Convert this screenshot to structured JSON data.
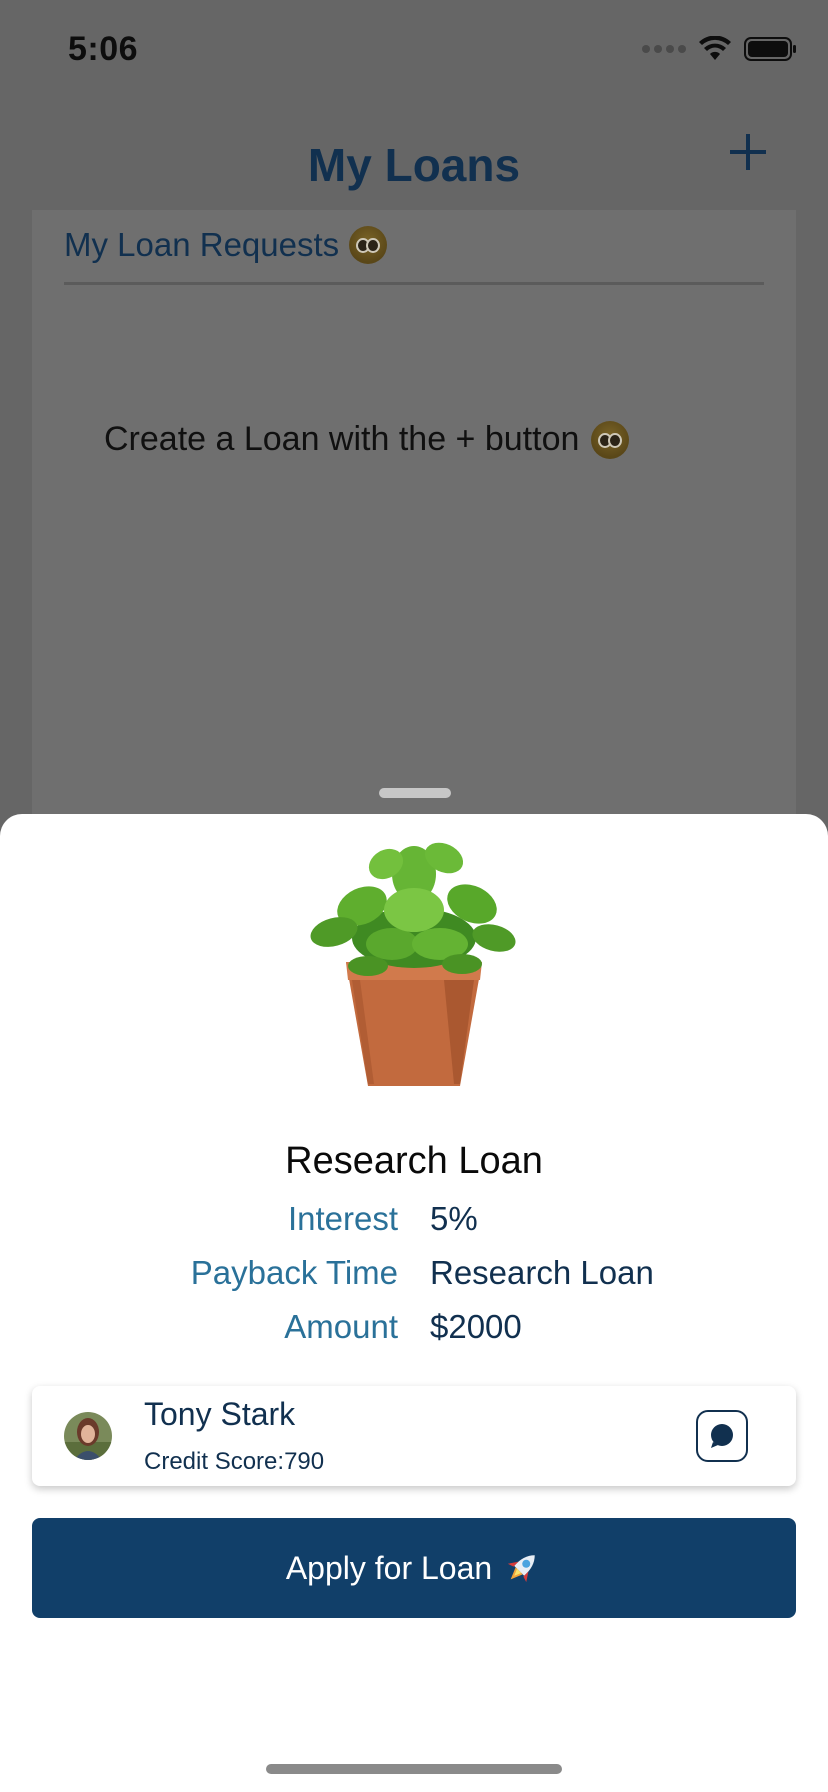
{
  "status_bar": {
    "time": "5:06"
  },
  "nav": {
    "title": "My Loans",
    "add_icon": "plus-icon"
  },
  "requests": {
    "header": "My Loan Requests",
    "empty_text": "Create a Loan with the + button"
  },
  "loan": {
    "title": "Research Loan",
    "image": "potted-plant",
    "details": [
      {
        "label": "Interest",
        "value": "5%"
      },
      {
        "label": "Payback Time",
        "value": "Research Loan"
      },
      {
        "label": "Amount",
        "value": "$2000"
      }
    ]
  },
  "lender": {
    "name": "Tony Stark",
    "credit_label": "Credit Score:",
    "credit_score": "790",
    "chat_icon": "chat-bubble-icon"
  },
  "apply_button": {
    "label": "Apply for Loan",
    "icon": "rocket-icon"
  },
  "colors": {
    "brand_navy": "#11304f",
    "button": "#113f69",
    "label_blue": "#2a7199",
    "sheet": "#ffffff",
    "scrim": "#666666"
  }
}
